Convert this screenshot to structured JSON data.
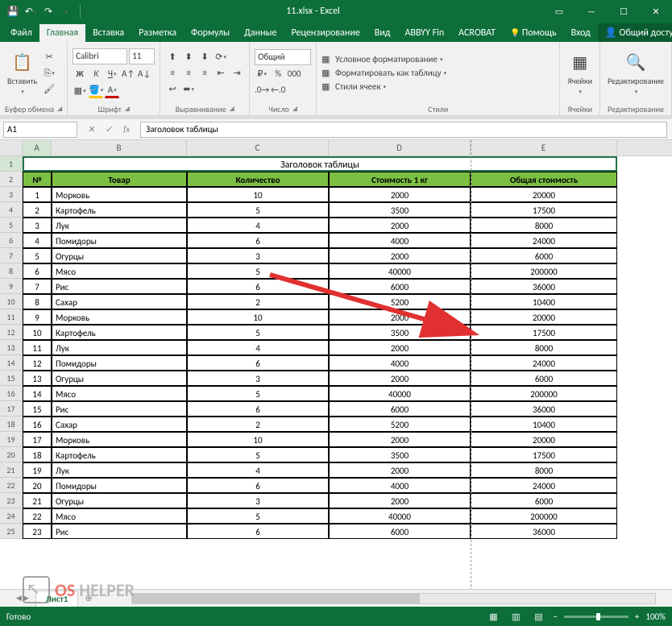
{
  "title": "11.xlsx - Excel",
  "tabs": {
    "file": "Файл",
    "home": "Главная",
    "insert": "Вставка",
    "layout": "Разметка",
    "formulas": "Формулы",
    "data": "Данные",
    "review": "Рецензирование",
    "view": "Вид",
    "abbyy": "ABBYY Fin",
    "acrobat": "ACROBAT",
    "help": "Помощь",
    "login": "Вход",
    "share": "Общий доступ"
  },
  "ribbon": {
    "clipboard": {
      "label": "Буфер обмена",
      "paste": "Вставить"
    },
    "font": {
      "label": "Шрифт",
      "name": "Calibri",
      "size": "11"
    },
    "align": {
      "label": "Выравнивание"
    },
    "number": {
      "label": "Число",
      "format": "Общий"
    },
    "styles": {
      "label": "Стили",
      "cond": "Условное форматирование",
      "table": "Форматировать как таблицу",
      "cell": "Стили ячеек"
    },
    "cells": {
      "label": "Ячейки"
    },
    "editing": {
      "label": "Редактирование"
    }
  },
  "nameBox": "A1",
  "formula": "Заголовок таблицы",
  "columns": [
    "A",
    "B",
    "C",
    "D",
    "E"
  ],
  "table": {
    "title": "Заголовок таблицы",
    "headers": {
      "n": "№",
      "product": "Товар",
      "qty": "Количество",
      "price": "Стоимость 1 кг",
      "total": "Общая стоимость"
    },
    "rows": [
      {
        "n": "1",
        "product": "Морковь",
        "qty": "10",
        "price": "2000",
        "total": "20000"
      },
      {
        "n": "2",
        "product": "Картофель",
        "qty": "5",
        "price": "3500",
        "total": "17500"
      },
      {
        "n": "3",
        "product": "Лук",
        "qty": "4",
        "price": "2000",
        "total": "8000"
      },
      {
        "n": "4",
        "product": "Помидоры",
        "qty": "6",
        "price": "4000",
        "total": "24000"
      },
      {
        "n": "5",
        "product": "Огурцы",
        "qty": "3",
        "price": "2000",
        "total": "6000"
      },
      {
        "n": "6",
        "product": "Мясо",
        "qty": "5",
        "price": "40000",
        "total": "200000"
      },
      {
        "n": "7",
        "product": "Рис",
        "qty": "6",
        "price": "6000",
        "total": "36000"
      },
      {
        "n": "8",
        "product": "Сахар",
        "qty": "2",
        "price": "5200",
        "total": "10400"
      },
      {
        "n": "9",
        "product": "Морковь",
        "qty": "10",
        "price": "2000",
        "total": "20000"
      },
      {
        "n": "10",
        "product": "Картофель",
        "qty": "5",
        "price": "3500",
        "total": "17500"
      },
      {
        "n": "11",
        "product": "Лук",
        "qty": "4",
        "price": "2000",
        "total": "8000"
      },
      {
        "n": "12",
        "product": "Помидоры",
        "qty": "6",
        "price": "4000",
        "total": "24000"
      },
      {
        "n": "13",
        "product": "Огурцы",
        "qty": "3",
        "price": "2000",
        "total": "6000"
      },
      {
        "n": "14",
        "product": "Мясо",
        "qty": "5",
        "price": "40000",
        "total": "200000"
      },
      {
        "n": "15",
        "product": "Рис",
        "qty": "6",
        "price": "6000",
        "total": "36000"
      },
      {
        "n": "16",
        "product": "Сахар",
        "qty": "2",
        "price": "5200",
        "total": "10400"
      },
      {
        "n": "17",
        "product": "Морковь",
        "qty": "10",
        "price": "2000",
        "total": "20000"
      },
      {
        "n": "18",
        "product": "Картофель",
        "qty": "5",
        "price": "3500",
        "total": "17500"
      },
      {
        "n": "19",
        "product": "Лук",
        "qty": "4",
        "price": "2000",
        "total": "8000"
      },
      {
        "n": "20",
        "product": "Помидоры",
        "qty": "6",
        "price": "4000",
        "total": "24000"
      },
      {
        "n": "21",
        "product": "Огурцы",
        "qty": "3",
        "price": "2000",
        "total": "6000"
      },
      {
        "n": "22",
        "product": "Мясо",
        "qty": "5",
        "price": "40000",
        "total": "200000"
      },
      {
        "n": "23",
        "product": "Рис",
        "qty": "6",
        "price": "6000",
        "total": "36000"
      }
    ]
  },
  "sheet": "Лист1",
  "status": {
    "ready": "Готово",
    "zoom": "100%"
  },
  "watermark": {
    "os": "OS",
    "helper": "HELPER"
  }
}
